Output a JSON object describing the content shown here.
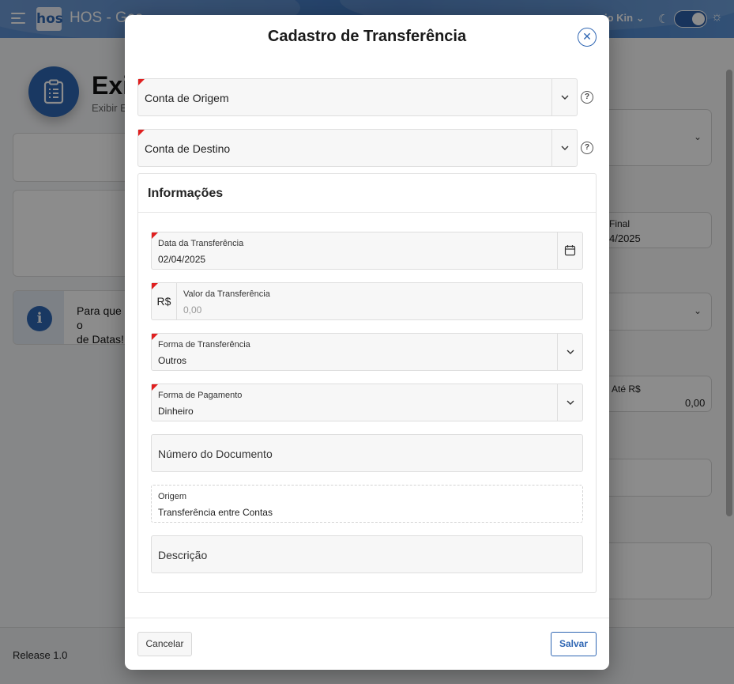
{
  "app": {
    "logo_text": "hos",
    "title": "HOS - Ges",
    "user_name": "io Kin",
    "release": "Release 1.0"
  },
  "background": {
    "page_title": "Exi",
    "page_subtitle": "Exibir E",
    "info_text_line1": "Para que o",
    "info_text_line2": "de Datas!",
    "right_final_label": "Final",
    "right_final_value": "4/2025",
    "right_ate_label": "Até R$",
    "right_ate_value": "0,00"
  },
  "modal": {
    "title": "Cadastro de Transferência",
    "conta_origem": "Conta de Origem",
    "conta_destino": "Conta de Destino",
    "help_symbol": "?",
    "info_section_title": "Informações",
    "fields": {
      "data_label": "Data da Transferência",
      "data_value": "02/04/2025",
      "valor_currency": "R$",
      "valor_label": "Valor da Transferência",
      "valor_placeholder": "0,00",
      "forma_transf_label": "Forma de Transferência",
      "forma_transf_value": "Outros",
      "forma_pag_label": "Forma de Pagamento",
      "forma_pag_value": "Dinheiro",
      "numero_doc_placeholder": "Número do Documento",
      "origem_label": "Origem",
      "origem_value": "Transferência entre Contas",
      "descricao_placeholder": "Descrição"
    },
    "buttons": {
      "cancel": "Cancelar",
      "save": "Salvar"
    }
  },
  "colors": {
    "accent": "#2f66b3",
    "required_marker": "#e02020"
  }
}
